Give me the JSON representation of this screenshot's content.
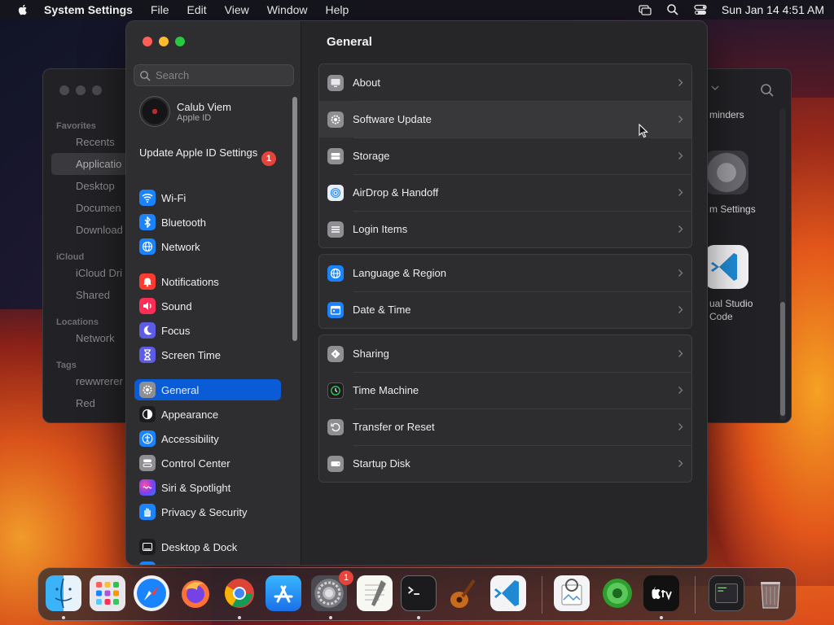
{
  "menubar": {
    "app_name": "System Settings",
    "menus": [
      "File",
      "Edit",
      "View",
      "Window",
      "Help"
    ],
    "clock": "Sun Jan 14  4:51 AM"
  },
  "finder": {
    "sections": {
      "favorites": "Favorites",
      "icloud": "iCloud",
      "locations": "Locations",
      "tags": "Tags"
    },
    "favorites": [
      "Recents",
      "Applicatio",
      "Desktop",
      "Documen",
      "Download"
    ],
    "icloud": [
      "iCloud Dri",
      "Shared"
    ],
    "locations": [
      "Network"
    ],
    "tags": [
      "rewwrerer",
      "Red"
    ],
    "peek": {
      "label_1": "minders",
      "label_2": "m Settings",
      "label_3a": "ual Studio",
      "label_3b": "Code"
    }
  },
  "settings": {
    "search": {
      "placeholder": "Search"
    },
    "account": {
      "name": "Calub Viem",
      "subtitle": "Apple ID"
    },
    "update": {
      "label": "Update Apple ID Settings",
      "badge": "1"
    },
    "sidebar": [
      {
        "label": "Wi-Fi",
        "icon": "wifi-icon",
        "color": "#1a84ff"
      },
      {
        "label": "Bluetooth",
        "icon": "bluetooth-icon",
        "color": "#1a84ff"
      },
      {
        "label": "Network",
        "icon": "globe-icon",
        "color": "#1a84ff"
      },
      {
        "label": "Notifications",
        "icon": "bell-icon",
        "color": "#ff3b30"
      },
      {
        "label": "Sound",
        "icon": "speaker-icon",
        "color": "#ff2d55"
      },
      {
        "label": "Focus",
        "icon": "moon-icon",
        "color": "#5e5ce6"
      },
      {
        "label": "Screen Time",
        "icon": "hourglass-icon",
        "color": "#5e5ce6"
      },
      {
        "label": "General",
        "icon": "gear-icon",
        "color": "#8e8e93",
        "selected": true
      },
      {
        "label": "Appearance",
        "icon": "appearance-icon",
        "color": "#1c1c1e"
      },
      {
        "label": "Accessibility",
        "icon": "accessibility-icon",
        "color": "#1a84ff"
      },
      {
        "label": "Control Center",
        "icon": "control-center-icon",
        "color": "#8e8e93"
      },
      {
        "label": "Siri & Spotlight",
        "icon": "siri-icon",
        "color": "#b048d8"
      },
      {
        "label": "Privacy & Security",
        "icon": "hand-icon",
        "color": "#1a84ff"
      },
      {
        "label": "Desktop & Dock",
        "icon": "dock-icon",
        "color": "#1c1c1e"
      }
    ],
    "pane": {
      "title": "General",
      "groups": [
        [
          {
            "label": "About",
            "icon": "display-icon"
          },
          {
            "label": "Software Update",
            "icon": "gear-badge-icon"
          },
          {
            "label": "Storage",
            "icon": "drive-icon"
          },
          {
            "label": "AirDrop & Handoff",
            "icon": "airdrop-icon"
          },
          {
            "label": "Login Items",
            "icon": "list-icon"
          }
        ],
        [
          {
            "label": "Language & Region",
            "icon": "globe-icon"
          },
          {
            "label": "Date & Time",
            "icon": "calendar-icon"
          }
        ],
        [
          {
            "label": "Sharing",
            "icon": "sharing-icon"
          },
          {
            "label": "Time Machine",
            "icon": "time-machine-icon"
          },
          {
            "label": "Transfer or Reset",
            "icon": "reset-icon"
          },
          {
            "label": "Startup Disk",
            "icon": "disk-icon"
          }
        ]
      ]
    }
  },
  "dock": {
    "apps": [
      "Finder",
      "Launchpad",
      "Safari",
      "Firefox",
      "Chrome",
      "App Store",
      "System Settings",
      "TextEdit",
      "Terminal",
      "GarageBand",
      "Visual Studio Code",
      "Preview",
      "HDR",
      "Apple TV",
      "Console",
      "Trash"
    ],
    "settings_badge": "1"
  }
}
